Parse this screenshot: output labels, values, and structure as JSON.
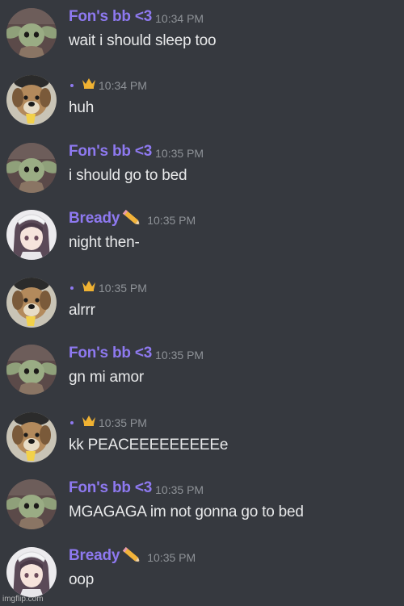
{
  "colors": {
    "background": "#36393f",
    "username": "#8e79f0",
    "timestamp": "#8e9297",
    "message_text": "#e8e9ea",
    "crown": "#f0b232"
  },
  "messages": [
    {
      "author": "Fon's bb <3",
      "avatar": "baby-yoda-avatar",
      "badge": "",
      "time": "10:34 PM",
      "text": "wait i should sleep too"
    },
    {
      "author": "·",
      "avatar": "dog-avatar",
      "badge": "crown-icon",
      "time": "10:34 PM",
      "text": "huh"
    },
    {
      "author": "Fon's bb <3",
      "avatar": "baby-yoda-avatar",
      "badge": "",
      "time": "10:35 PM",
      "text": "i should go to bed"
    },
    {
      "author": "Bready",
      "avatar": "anime-girl-avatar",
      "badge": "pencil-icon",
      "time": "10:35 PM",
      "text": "night then-"
    },
    {
      "author": "·",
      "avatar": "dog-avatar",
      "badge": "crown-icon",
      "time": "10:35 PM",
      "text": "alrrr"
    },
    {
      "author": "Fon's bb <3",
      "avatar": "baby-yoda-avatar",
      "badge": "",
      "time": "10:35 PM",
      "text": "gn mi amor"
    },
    {
      "author": "·",
      "avatar": "dog-avatar",
      "badge": "crown-icon",
      "time": "10:35 PM",
      "text": "kk PEACEEEEEEEEEe"
    },
    {
      "author": "Fon's bb <3",
      "avatar": "baby-yoda-avatar",
      "badge": "",
      "time": "10:35 PM",
      "text": "MGAGAGA im not gonna go to bed"
    },
    {
      "author": "Bready",
      "avatar": "anime-girl-avatar",
      "badge": "pencil-icon",
      "time": "10:35 PM",
      "text": "oop"
    }
  ],
  "watermark": "imgflip.com"
}
